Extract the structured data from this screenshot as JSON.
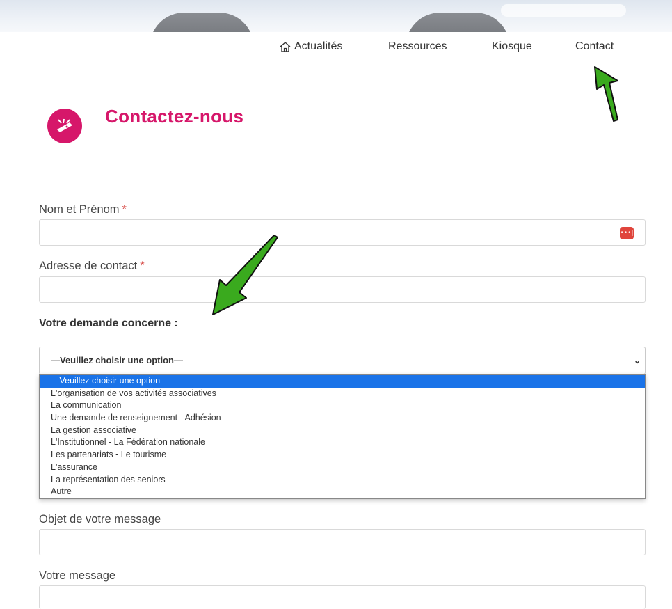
{
  "nav": {
    "home": "Actualités",
    "resources": "Ressources",
    "kiosk": "Kiosque",
    "contact": "Contact"
  },
  "page": {
    "title": "Contactez-nous"
  },
  "form": {
    "name_label": "Nom et Prénom",
    "required_mark": "*",
    "email_label": "Adresse de contact",
    "topic_label": "Votre demande concerne :",
    "topic_selected": "—Veuillez choisir une option—",
    "topic_options": [
      "—Veuillez choisir une option—",
      "L'organisation de vos activités associatives",
      "La communication",
      "Une demande de renseignement - Adhésion",
      "La gestion associative",
      "L'Institutionnel - La Fédération nationale",
      "Les partenariats - Le tourisme",
      "L'assurance",
      "La représentation des seniors",
      "Autre"
    ],
    "subject_label": "Objet de votre message",
    "message_label": "Votre message"
  },
  "password_icon_text": "•••|",
  "colors": {
    "brand": "#d6176a",
    "arrow": "#3aaa1e",
    "selected": "#1a73e8"
  }
}
